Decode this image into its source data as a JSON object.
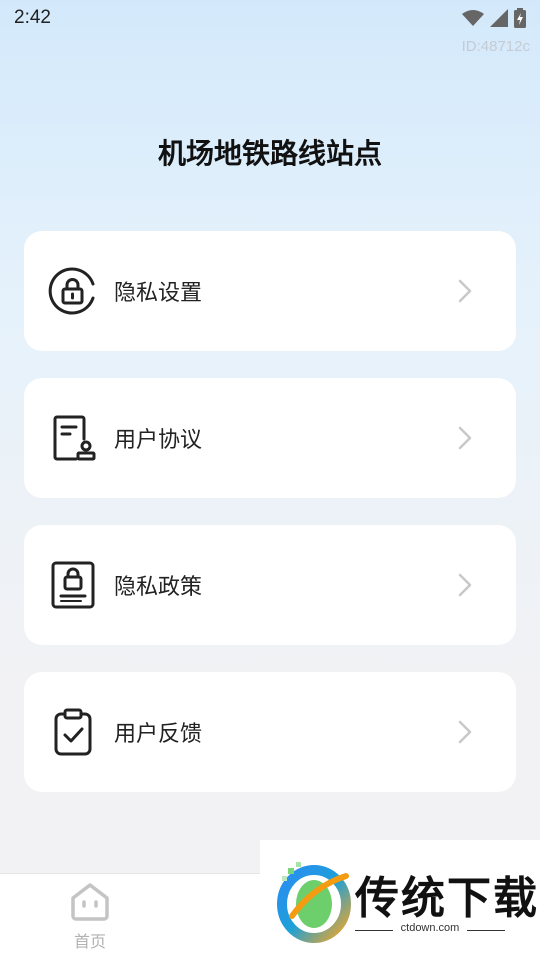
{
  "status_bar": {
    "time": "2:42"
  },
  "id_label": "ID:48712c",
  "title": "机场地铁路线站点",
  "menu": [
    {
      "label": "隐私设置",
      "icon": "lock-circle-icon"
    },
    {
      "label": "用户协议",
      "icon": "document-stamp-icon"
    },
    {
      "label": "隐私政策",
      "icon": "lock-document-icon"
    },
    {
      "label": "用户反馈",
      "icon": "clipboard-check-icon"
    }
  ],
  "tabs": [
    {
      "label": "首页",
      "icon": "home-face-icon"
    },
    {
      "label": "…",
      "icon": "tab2-icon"
    }
  ],
  "promo": {
    "brand": "传统下载",
    "url": "ctdown.com"
  },
  "colors": {
    "card_bg": "#ffffff",
    "icon_stroke": "#222222",
    "chevron": "#c8c8c8",
    "tab_inactive": "#b2b2b2"
  }
}
